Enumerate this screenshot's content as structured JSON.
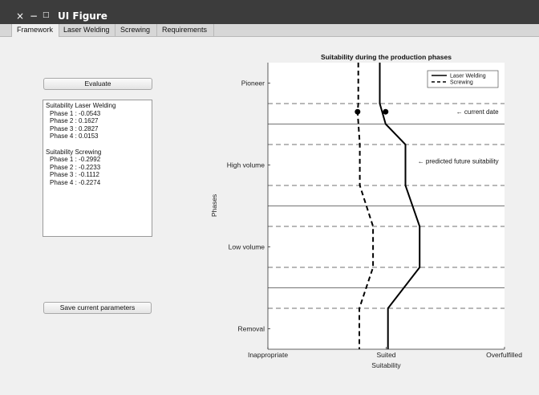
{
  "window": {
    "title": "UI Figure",
    "controls": {
      "close": "×",
      "minimize": "−",
      "maximize": "□"
    }
  },
  "tabs": [
    {
      "label": "Framework",
      "active": true
    },
    {
      "label": "Laser Welding",
      "active": false
    },
    {
      "label": "Screwing",
      "active": false
    },
    {
      "label": "Requirements",
      "active": false
    }
  ],
  "framework": {
    "evaluate_label": "Evaluate",
    "save_label": "Save current parameters",
    "results": {
      "laser": {
        "heading": "Suitability Laser Welding",
        "phases": [
          "Phase 1 : -0.0543",
          "Phase 2 : 0.1627",
          "Phase 3 : 0.2827",
          "Phase 4 : 0.0153"
        ]
      },
      "screwing": {
        "heading": "Suitability Screwing",
        "phases": [
          "Phase 1 : -0.2992",
          "Phase 2 : -0.2233",
          "Phase 3 : -0.1112",
          "Phase 4 : -0.2274"
        ]
      }
    }
  },
  "chart_data": {
    "type": "line",
    "title": "Suitability during the production phases",
    "xlabel": "Suitability",
    "ylabel": "Phases",
    "xlim": [
      -1,
      1
    ],
    "ylim": [
      0,
      7
    ],
    "x_ticks": [
      {
        "value": -1,
        "label": "Inappropriate"
      },
      {
        "value": 0,
        "label": "Suited"
      },
      {
        "value": 1,
        "label": "Overfulfilled"
      }
    ],
    "y_ticks": [
      {
        "value": 6.5,
        "label": "Pioneer"
      },
      {
        "value": 4.5,
        "label": "High volume"
      },
      {
        "value": 2.5,
        "label": "Low volume"
      },
      {
        "value": 0.5,
        "label": "Removal"
      }
    ],
    "solid_lines": [
      1.5,
      3.5,
      5.5
    ],
    "dashed_lines": [
      1,
      2,
      3,
      4,
      5,
      6
    ],
    "legend": {
      "position": "top-right",
      "entries": [
        "Laser Welding",
        "Screwing"
      ]
    },
    "series": [
      {
        "name": "Laser Welding",
        "style": "solid",
        "points": [
          [
            -0.054,
            7
          ],
          [
            -0.054,
            6
          ],
          [
            -0.005,
            5.5
          ],
          [
            0.163,
            5
          ],
          [
            0.163,
            4
          ],
          [
            0.283,
            3
          ],
          [
            0.283,
            2
          ],
          [
            0.015,
            1
          ],
          [
            0.015,
            0
          ]
        ]
      },
      {
        "name": "Screwing",
        "style": "dashed",
        "points": [
          [
            -0.236,
            7
          ],
          [
            -0.236,
            6
          ],
          [
            -0.242,
            5.8
          ],
          [
            -0.223,
            5
          ],
          [
            -0.223,
            4
          ],
          [
            -0.111,
            3
          ],
          [
            -0.111,
            2
          ],
          [
            -0.227,
            1
          ],
          [
            -0.227,
            0
          ]
        ]
      }
    ],
    "markers": [
      [
        -0.242,
        5.8
      ],
      [
        -0.005,
        5.8
      ]
    ],
    "annotations": [
      {
        "text": "← current date",
        "x": 0.95,
        "y": 5.8
      },
      {
        "text": "← predicted future suitability",
        "x": 0.95,
        "y": 4.6
      }
    ]
  }
}
